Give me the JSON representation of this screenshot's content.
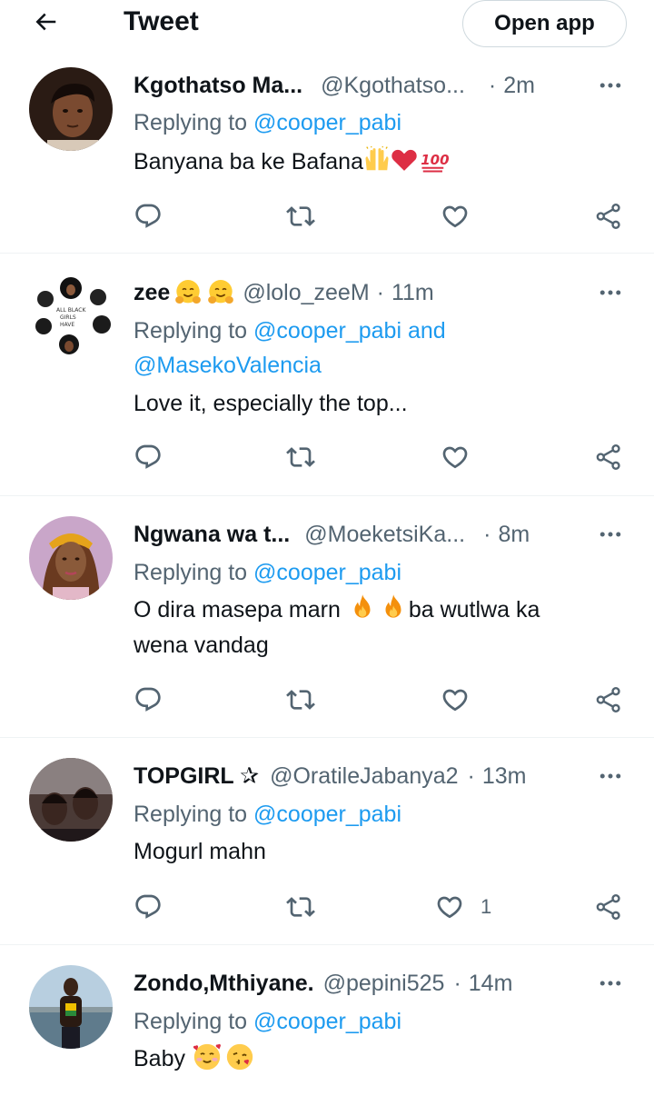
{
  "header": {
    "title": "Tweet",
    "open_app_label": "Open app"
  },
  "tweets": [
    {
      "name": "Kgothatso Ma...",
      "handle": "@Kgothatso...",
      "separator": "·",
      "time": "2m",
      "replying_prefix": "Replying to ",
      "replying_line1": "@cooper_pabi",
      "replying_line2": "",
      "text_line1": "Banyana ba ke Bafana",
      "text_line2": "",
      "likes": ""
    },
    {
      "name": "zee",
      "handle": "@lolo_zeeM",
      "separator": "·",
      "time": "11m",
      "replying_prefix": "Replying to ",
      "replying_line1": "@cooper_pabi and",
      "replying_line2": "@MasekoValencia",
      "text_line1": "Love it, especially the top...",
      "text_line2": "",
      "likes": ""
    },
    {
      "name": "Ngwana wa t...",
      "handle": "@MoeketsiKa...",
      "separator": "·",
      "time": "8m",
      "replying_prefix": "Replying to ",
      "replying_line1": "@cooper_pabi",
      "replying_line2": "",
      "text_line1": "O dira masepa marn ",
      "text_line1b": "ba wutlwa ka",
      "text_line2": "wena vandag",
      "likes": ""
    },
    {
      "name": "TOPGIRL ✰",
      "handle": "@OratileJabanya2",
      "separator": "·",
      "time": "13m",
      "replying_prefix": "Replying to ",
      "replying_line1": "@cooper_pabi",
      "replying_line2": "",
      "text_line1": "Mogurl mahn",
      "text_line2": "",
      "likes": "1"
    },
    {
      "name": "Zondo,Mthiyane.",
      "handle": "@pepini525",
      "separator": "·",
      "time": "14m",
      "replying_prefix": "Replying to ",
      "replying_line1": "@cooper_pabi",
      "replying_line2": "",
      "text_line1": "Baby ",
      "text_line2": "",
      "likes": ""
    }
  ],
  "icons": {
    "back": "arrow-left-icon",
    "more": "more-horizontal-icon",
    "reply": "reply-icon",
    "retweet": "retweet-icon",
    "like": "heart-icon",
    "share": "share-icon"
  },
  "colors": {
    "link": "#1d9bf0",
    "secondary": "#536471",
    "text": "#0f1419",
    "divider": "#eff3f4"
  }
}
